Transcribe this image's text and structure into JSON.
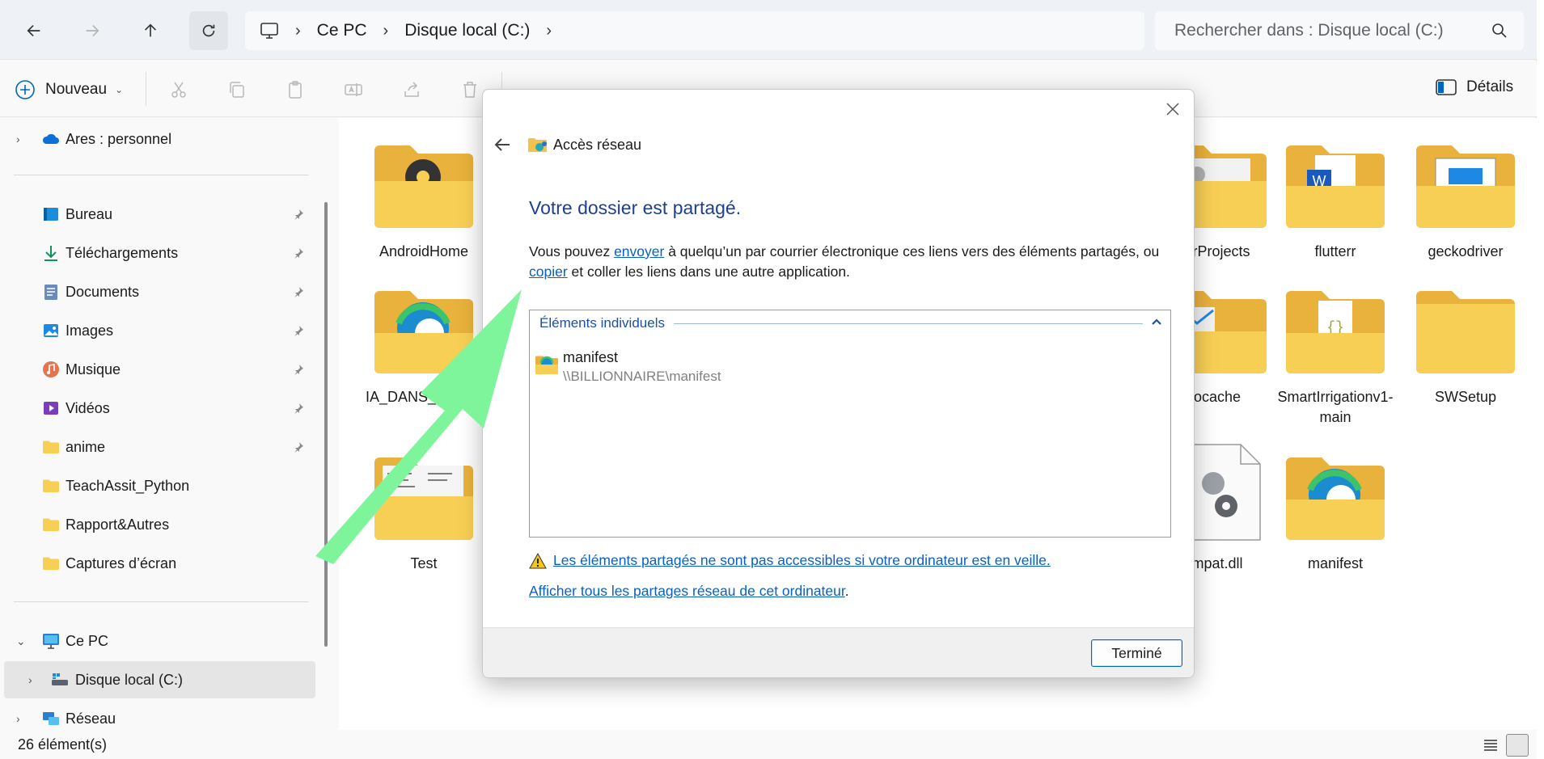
{
  "addressbar": {
    "breadcrumb": [
      "Ce PC",
      "Disque local (C:)"
    ],
    "search_placeholder": "Rechercher dans : Disque local (C:)"
  },
  "toolbar": {
    "new_label": "Nouveau",
    "details_label": "Détails"
  },
  "sidebar": {
    "onedrive": {
      "label": "Ares : personnel",
      "icon": "cloud-icon"
    },
    "quick_access": [
      {
        "label": "Bureau",
        "icon": "desktop-icon"
      },
      {
        "label": "Téléchargements",
        "icon": "download-icon"
      },
      {
        "label": "Documents",
        "icon": "document-icon"
      },
      {
        "label": "Images",
        "icon": "picture-icon"
      },
      {
        "label": "Musique",
        "icon": "music-icon"
      },
      {
        "label": "Vidéos",
        "icon": "video-icon"
      },
      {
        "label": "anime",
        "icon": "folder-icon"
      },
      {
        "label": "TeachAssit_Python",
        "icon": "folder-icon"
      },
      {
        "label": "Rapport&Autres",
        "icon": "folder-icon"
      },
      {
        "label": "Captures d’écran",
        "icon": "folder-icon"
      }
    ],
    "this_pc": {
      "label": "Ce PC",
      "icon": "computer-icon"
    },
    "local_disk": {
      "label": "Disque local (C:)",
      "icon": "drive-icon"
    },
    "network": {
      "label": "Réseau",
      "icon": "network-icon"
    }
  },
  "files": [
    {
      "name": "AndroidHome",
      "type": "folder-settings"
    },
    {
      "name": "erProjects",
      "type": "folder-settings"
    },
    {
      "name": "flutterr",
      "type": "folder-word"
    },
    {
      "name": "geckodriver",
      "type": "folder-window"
    },
    {
      "name": "IA_DANS_WORD",
      "type": "folder-edge"
    },
    {
      "name": "ocache",
      "type": "folder-mail"
    },
    {
      "name": "SmartIrrigationv1-main",
      "type": "folder-code"
    },
    {
      "name": "SWSetup",
      "type": "folder"
    },
    {
      "name": "Test",
      "type": "folder-notes"
    },
    {
      "name": "mpat.dll",
      "type": "dll"
    },
    {
      "name": "manifest",
      "type": "folder-edge"
    }
  ],
  "statusbar": {
    "count": "26 élément(s)"
  },
  "dialog": {
    "title": "Accès réseau",
    "heading": "Votre dossier est partagé.",
    "text_before": "Vous pouvez ",
    "link_send": "envoyer",
    "text_middle": " à quelqu’un par courrier électronique ces liens vers des éléments partagés, ou ",
    "link_copy": "copier",
    "text_after": " et coller les liens dans une autre application.",
    "group_label": "Éléments individuels",
    "item_name": "manifest",
    "item_path": "\\\\BILLIONNAIRE\\manifest",
    "warning_link": "Les éléments partagés ne sont pas accessibles si votre ordinateur est en veille.",
    "all_shares_link": "Afficher tous les partages réseau de cet ordinateur",
    "all_shares_suffix": ".",
    "done_label": "Terminé"
  },
  "colors": {
    "accent": "#0067c0",
    "heading_blue": "#1e3f93",
    "link_blue": "#0b5fc0",
    "annotation_green": "#7ef59a",
    "folder_yellow": "#f8cf55"
  }
}
